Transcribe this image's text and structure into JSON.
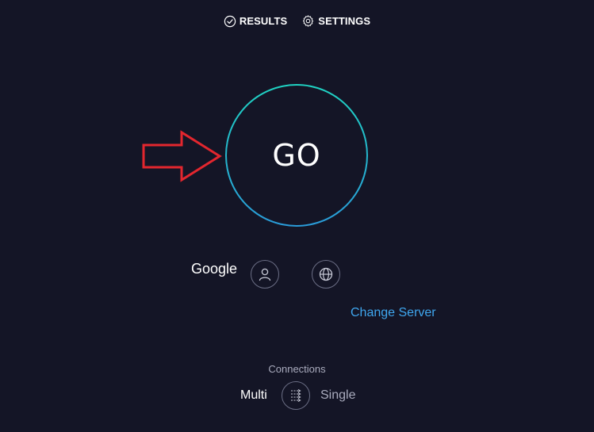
{
  "nav": {
    "results_label": "RESULTS",
    "settings_label": "SETTINGS"
  },
  "go_button": {
    "label": "GO"
  },
  "server": {
    "provider_name": "Google",
    "change_server_label": "Change Server"
  },
  "connections": {
    "label": "Connections",
    "options": [
      "Multi",
      "Single"
    ],
    "selected": "Multi"
  },
  "icons": {
    "results": "check-circle-icon",
    "settings": "gear-icon",
    "user": "user-icon",
    "globe": "globe-icon",
    "connections_toggle": "multi-connection-icon",
    "annotation": "red-arrow-icon"
  },
  "colors": {
    "background": "#141526",
    "ring_start": "#1fd3c2",
    "ring_end": "#2a9bd9",
    "link": "#3fa6ee",
    "annotation_arrow": "#e3262e"
  }
}
